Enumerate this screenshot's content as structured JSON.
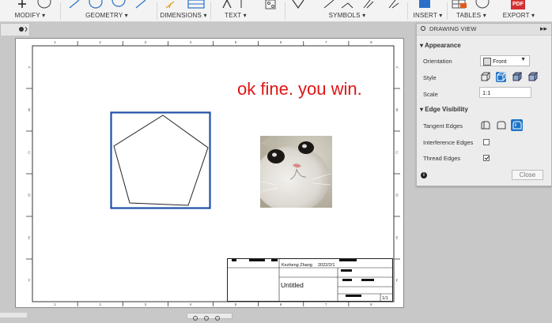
{
  "toolbar": {
    "groups": [
      {
        "label": "MODIFY ▾"
      },
      {
        "label": "GEOMETRY ▾"
      },
      {
        "label": "DIMENSIONS ▾"
      },
      {
        "label": "TEXT ▾"
      },
      {
        "label": "SYMBOLS ▾"
      },
      {
        "label": "INSERT ▾"
      },
      {
        "label": "TABLES ▾"
      },
      {
        "label": "EXPORT ▾"
      }
    ],
    "pdf_badge": "PDF"
  },
  "sheet": {
    "annotation": "ok fine. you win.",
    "border_col_labels": [
      "1",
      "2",
      "3",
      "4",
      "5",
      "6",
      "7",
      "8"
    ],
    "border_row_labels": [
      "A",
      "B",
      "C",
      "D",
      "E",
      "F"
    ],
    "title_block": {
      "author": "Kezheng Zhang",
      "date": "2022/2/1",
      "title": "Untitled",
      "sheet_number": "1/1"
    }
  },
  "panel": {
    "title": "DRAWING VIEW",
    "appearance_heading": "Appearance",
    "orientation_label": "Orientation",
    "orientation_value": "Front",
    "style_label": "Style",
    "scale_label": "Scale",
    "scale_value": "1:1",
    "edge_visibility_heading": "Edge Visibility",
    "tangent_edges_label": "Tangent Edges",
    "interference_edges_label": "Interference Edges",
    "interference_edges_checked": false,
    "thread_edges_label": "Thread Edges",
    "thread_edges_checked": true,
    "close_label": "Close"
  },
  "colors": {
    "annotation": "#e01414",
    "selection": "#1f4fa8",
    "selected_button": "#1e73c8"
  }
}
